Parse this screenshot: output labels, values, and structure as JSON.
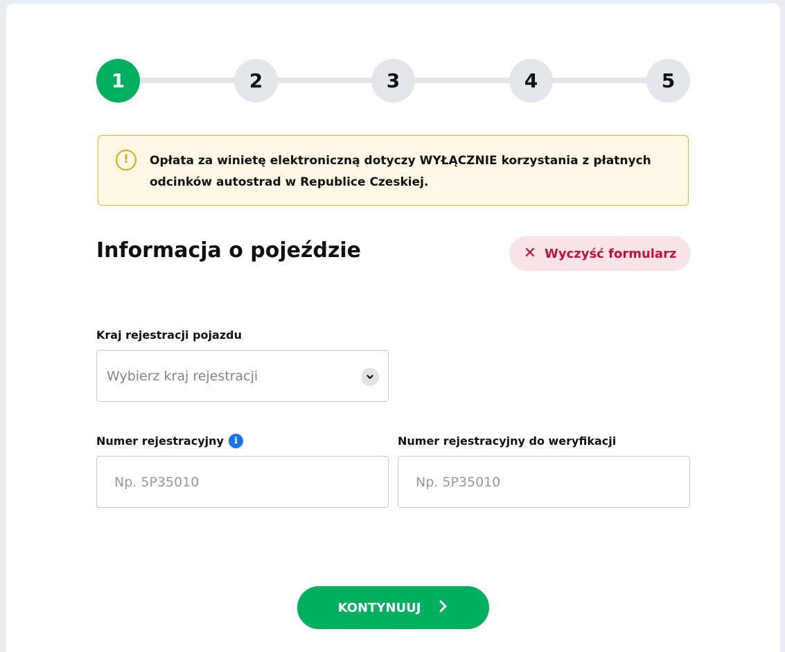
{
  "stepper": {
    "steps": [
      "1",
      "2",
      "3",
      "4",
      "5"
    ],
    "active_step": 1,
    "active_color": "#00b05e"
  },
  "alert": {
    "icon": "warning-circle-icon",
    "text": "Opłata za winietę elektroniczną dotyczy WYŁĄCZNIE korzystania z płatnych odcinków autostrad w Republice Czeskiej."
  },
  "section": {
    "title": "Informacja o pojeździe",
    "clear_label": "Wyczyść formularz",
    "clear_color": "#c4113c"
  },
  "form": {
    "country_label": "Kraj rejestracji pojazdu",
    "country_placeholder": "Wybierz kraj rejestracji",
    "plate_label": "Numer rejestracyjny",
    "plate_placeholder": "Np. 5P35010",
    "plate_verify_label": "Numer rejestracyjny do weryfikacji",
    "plate_verify_placeholder": "Np. 5P35010",
    "info_icon": "i"
  },
  "actions": {
    "continue_label": "KONTYNUUJ"
  }
}
